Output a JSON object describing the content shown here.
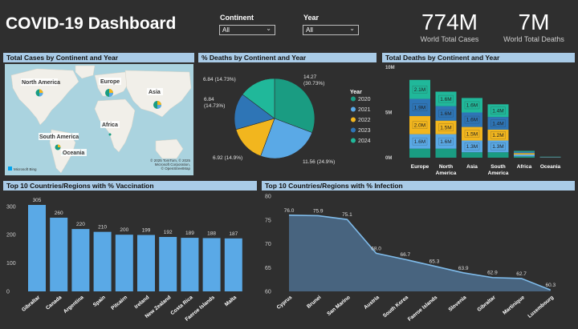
{
  "title": "COVID-19 Dashboard",
  "filters": [
    {
      "label": "Continent",
      "value": "All"
    },
    {
      "label": "Year",
      "value": "All"
    }
  ],
  "kpis": [
    {
      "value": "774M",
      "label": "World Total Cases"
    },
    {
      "value": "7M",
      "label": "World Total Deaths"
    }
  ],
  "panels": {
    "map_title": "Total Cases by Continent and Year",
    "pie_title": "% Deaths by Continent and Year",
    "stack_title": "Total Deaths by Continent and Year",
    "vacc_title": "Top 10 Countries/Regions with % Vaccination",
    "infect_title": "Top 10 Countries/Regions with % Infection"
  },
  "map": {
    "labels": [
      "North America",
      "Europe",
      "Asia",
      "Africa",
      "South America",
      "Oceania"
    ],
    "logo": "Microsoft Bing",
    "credit_lines": [
      "© 2025 TomTom, © 2025",
      "Microsoft Corporation,",
      "© OpenStreetMap"
    ]
  },
  "colors": {
    "2020": "#1a9c82",
    "2021": "#5aa9e6",
    "2022": "#f2b61e",
    "2023": "#2e75b6",
    "2024": "#20b89a",
    "panel_header": "#a9cbe7",
    "bar_blue": "#5aa9e6"
  },
  "chart_data": [
    {
      "type": "pie",
      "title": "% Deaths by Continent and Year",
      "legend_title": "Year",
      "legend": [
        "2020",
        "2021",
        "2022",
        "2023",
        "2024"
      ],
      "slices": [
        {
          "label": "2020",
          "value": 14.27,
          "percent": 30.73,
          "text": "14.27 (30.73%)"
        },
        {
          "label": "2021",
          "value": 11.56,
          "percent": 24.9,
          "text": "11.56 (24.9%)"
        },
        {
          "label": "2022",
          "value": 6.92,
          "percent": 14.9,
          "text": "6.92 (14.9%)"
        },
        {
          "label": "2023",
          "value": 6.84,
          "percent": 14.73,
          "text": "6.84 (14.73%)"
        },
        {
          "label": "2024",
          "value": 6.84,
          "percent": 14.73,
          "text": "6.84 (14.73%)"
        }
      ]
    },
    {
      "type": "bar",
      "stacked": true,
      "title": "Total Deaths by Continent and Year",
      "categories": [
        "Europe",
        "North America",
        "Asia",
        "South America",
        "Africa",
        "Oceania"
      ],
      "ylim": [
        0,
        10
      ],
      "yticks": [
        "0M",
        "5M",
        "10M"
      ],
      "series": [
        {
          "name": "2020",
          "values": [
            1.0,
            1.0,
            0.6,
            0.6,
            0.15,
            0.02
          ],
          "labels": [
            "",
            "",
            "",
            "",
            "",
            ""
          ]
        },
        {
          "name": "2021",
          "values": [
            1.6,
            1.6,
            1.3,
            1.3,
            0.2,
            0.03
          ],
          "labels": [
            "1.6M",
            "1.6M",
            "1.3M",
            "1.3M",
            "",
            ""
          ]
        },
        {
          "name": "2022",
          "values": [
            2.0,
            1.5,
            1.5,
            1.2,
            0.15,
            0.02
          ],
          "labels": [
            "2.0M",
            "1.5M",
            "1.5M",
            "1.2M",
            "",
            ""
          ]
        },
        {
          "name": "2023",
          "values": [
            1.9,
            1.6,
            1.6,
            1.4,
            0.15,
            0.02
          ],
          "labels": [
            "1.9M",
            "1.6M",
            "1.6M",
            "1.4M",
            "",
            ""
          ]
        },
        {
          "name": "2024",
          "values": [
            2.1,
            1.6,
            1.6,
            1.4,
            0.1,
            0.02
          ],
          "labels": [
            "2.1M",
            "1.6M",
            "1.6M",
            "1.4M",
            "",
            ""
          ]
        }
      ]
    },
    {
      "type": "bar",
      "title": "Top 10 Countries/Regions with % Vaccination",
      "categories": [
        "Gibraltar",
        "Canada",
        "Argentina",
        "Spain",
        "Pitcairn",
        "Ireland",
        "New Zealand",
        "Costa Rica",
        "Faeroe Islands",
        "Malta"
      ],
      "values": [
        305,
        260,
        220,
        210,
        200,
        199,
        192,
        189,
        188,
        187
      ],
      "ylim": [
        0,
        305
      ],
      "yticks": [
        0,
        100,
        200,
        300
      ]
    },
    {
      "type": "area",
      "title": "Top 10 Countries/Regions with % Infection",
      "categories": [
        "Cyprus",
        "Brunei",
        "San Marino",
        "Austria",
        "South Korea",
        "Faeroe Islands",
        "Slovenia",
        "Gibraltar",
        "Martinique",
        "Luxembourg"
      ],
      "values": [
        76.0,
        75.9,
        75.1,
        68.0,
        66.7,
        65.3,
        63.9,
        62.9,
        62.7,
        60.3
      ],
      "ylim": [
        60,
        80
      ],
      "yticks": [
        60,
        65,
        70,
        75,
        80
      ]
    }
  ]
}
